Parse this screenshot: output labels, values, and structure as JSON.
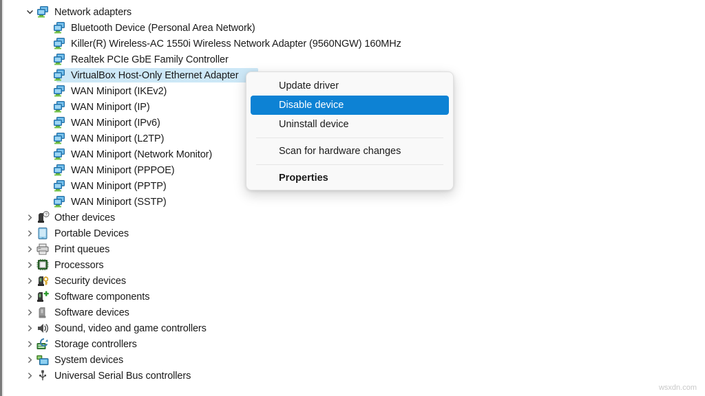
{
  "tree": {
    "items": [
      {
        "label": "Network adapters",
        "level": 0,
        "expanded": true,
        "icon": "network-adapter-icon",
        "selected": false
      },
      {
        "label": "Bluetooth Device (Personal Area Network)",
        "level": 1,
        "expanded": null,
        "icon": "network-adapter-icon",
        "selected": false
      },
      {
        "label": "Killer(R) Wireless-AC 1550i Wireless Network Adapter (9560NGW) 160MHz",
        "level": 1,
        "expanded": null,
        "icon": "network-adapter-icon",
        "selected": false
      },
      {
        "label": "Realtek PCIe GbE Family Controller",
        "level": 1,
        "expanded": null,
        "icon": "network-adapter-icon",
        "selected": false
      },
      {
        "label": "VirtualBox Host-Only Ethernet Adapter",
        "level": 1,
        "expanded": null,
        "icon": "network-adapter-icon",
        "selected": true
      },
      {
        "label": "WAN Miniport (IKEv2)",
        "level": 1,
        "expanded": null,
        "icon": "network-adapter-icon",
        "selected": false
      },
      {
        "label": "WAN Miniport (IP)",
        "level": 1,
        "expanded": null,
        "icon": "network-adapter-icon",
        "selected": false
      },
      {
        "label": "WAN Miniport (IPv6)",
        "level": 1,
        "expanded": null,
        "icon": "network-adapter-icon",
        "selected": false
      },
      {
        "label": "WAN Miniport (L2TP)",
        "level": 1,
        "expanded": null,
        "icon": "network-adapter-icon",
        "selected": false
      },
      {
        "label": "WAN Miniport (Network Monitor)",
        "level": 1,
        "expanded": null,
        "icon": "network-adapter-icon",
        "selected": false
      },
      {
        "label": "WAN Miniport (PPPOE)",
        "level": 1,
        "expanded": null,
        "icon": "network-adapter-icon",
        "selected": false
      },
      {
        "label": "WAN Miniport (PPTP)",
        "level": 1,
        "expanded": null,
        "icon": "network-adapter-icon",
        "selected": false
      },
      {
        "label": "WAN Miniport (SSTP)",
        "level": 1,
        "expanded": null,
        "icon": "network-adapter-icon",
        "selected": false
      },
      {
        "label": "Other devices",
        "level": 0,
        "expanded": false,
        "icon": "other-devices-icon",
        "selected": false
      },
      {
        "label": "Portable Devices",
        "level": 0,
        "expanded": false,
        "icon": "portable-device-icon",
        "selected": false
      },
      {
        "label": "Print queues",
        "level": 0,
        "expanded": false,
        "icon": "printer-icon",
        "selected": false
      },
      {
        "label": "Processors",
        "level": 0,
        "expanded": false,
        "icon": "processor-icon",
        "selected": false
      },
      {
        "label": "Security devices",
        "level": 0,
        "expanded": false,
        "icon": "security-device-icon",
        "selected": false
      },
      {
        "label": "Software components",
        "level": 0,
        "expanded": false,
        "icon": "software-component-icon",
        "selected": false
      },
      {
        "label": "Software devices",
        "level": 0,
        "expanded": false,
        "icon": "software-device-icon",
        "selected": false
      },
      {
        "label": "Sound, video and game controllers",
        "level": 0,
        "expanded": false,
        "icon": "speaker-icon",
        "selected": false
      },
      {
        "label": "Storage controllers",
        "level": 0,
        "expanded": false,
        "icon": "storage-controller-icon",
        "selected": false
      },
      {
        "label": "System devices",
        "level": 0,
        "expanded": false,
        "icon": "system-device-icon",
        "selected": false
      },
      {
        "label": "Universal Serial Bus controllers",
        "level": 0,
        "expanded": false,
        "icon": "usb-icon",
        "selected": false
      }
    ]
  },
  "context_menu": {
    "items": [
      {
        "label": "Update driver",
        "type": "item",
        "highlight": false,
        "bold": false
      },
      {
        "label": "Disable device",
        "type": "item",
        "highlight": true,
        "bold": false
      },
      {
        "label": "Uninstall device",
        "type": "item",
        "highlight": false,
        "bold": false
      },
      {
        "label": "",
        "type": "separator",
        "highlight": false,
        "bold": false
      },
      {
        "label": "Scan for hardware changes",
        "type": "item",
        "highlight": false,
        "bold": false
      },
      {
        "label": "",
        "type": "separator",
        "highlight": false,
        "bold": false
      },
      {
        "label": "Properties",
        "type": "item",
        "highlight": false,
        "bold": true
      }
    ]
  },
  "watermark": {
    "text": "wsxdn.com"
  },
  "colors": {
    "menu_highlight": "#0d82d4",
    "row_selection": "#cde8f7",
    "menu_background": "#f9f9f9"
  }
}
